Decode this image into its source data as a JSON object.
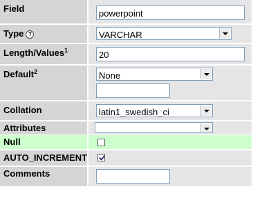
{
  "fields": {
    "field": {
      "label": "Field",
      "value": "powerpoint"
    },
    "type": {
      "label": "Type",
      "help_icon": "help-icon",
      "selected": "VARCHAR"
    },
    "length": {
      "label": "Length/Values",
      "footnote": "1",
      "value": "20"
    },
    "default": {
      "label": "Default",
      "footnote": "2",
      "selected": "None",
      "value": ""
    },
    "collation": {
      "label": "Collation",
      "selected": "latin1_swedish_ci"
    },
    "attributes": {
      "label": "Attributes",
      "selected": ""
    },
    "null": {
      "label": "Null",
      "checked": false
    },
    "auto_increment": {
      "label": "AUTO_INCREMENT",
      "checked": true
    },
    "comments": {
      "label": "Comments",
      "value": ""
    }
  },
  "colors": {
    "label_bg": "#d5d5d5",
    "value_bg": "#e5e5e5",
    "highlight_bg": "#ccffcc"
  }
}
